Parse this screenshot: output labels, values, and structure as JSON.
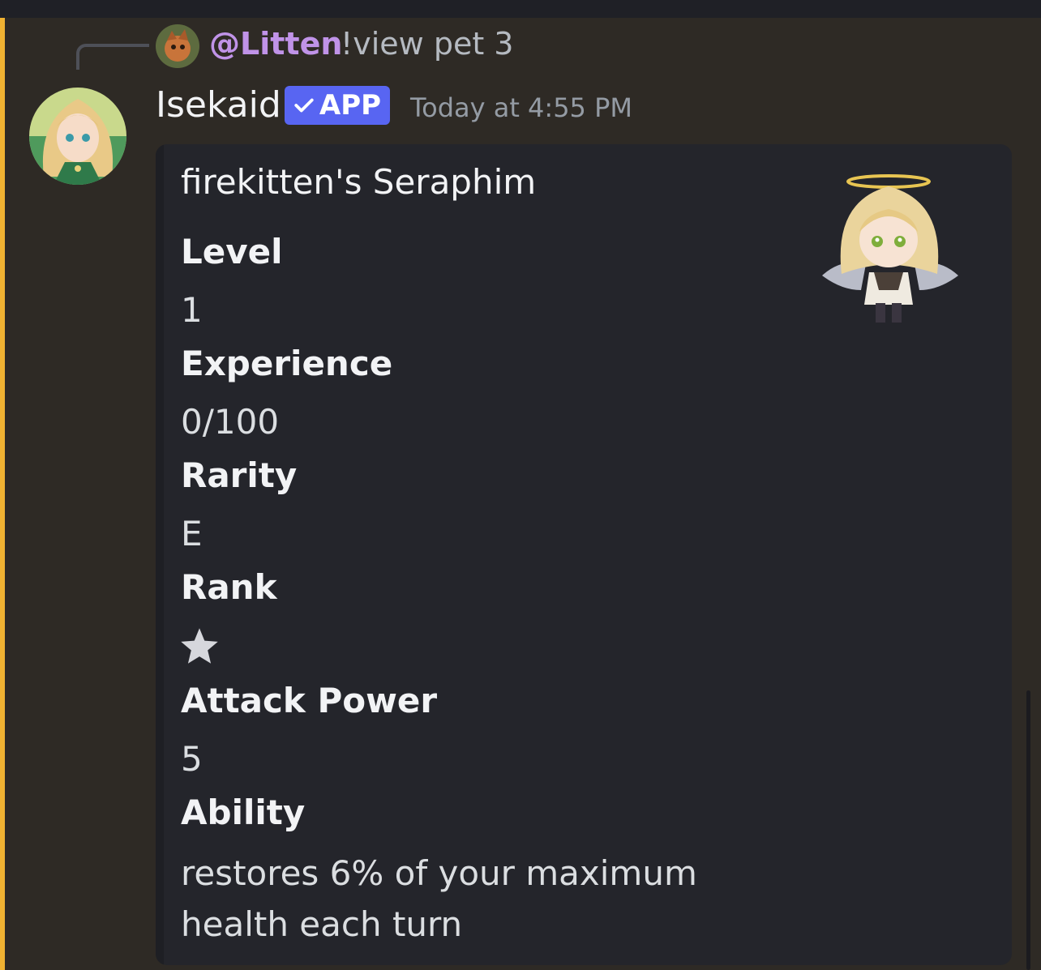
{
  "reply": {
    "username": "@Litten",
    "content": "!view pet 3"
  },
  "message": {
    "author": "Isekaid",
    "badge": "APP",
    "timestamp": "Today at 4:55 PM"
  },
  "embed": {
    "title": "firekitten's Seraphim",
    "fields": [
      {
        "name": "Level",
        "value": "1"
      },
      {
        "name": "Experience",
        "value": "0/100"
      },
      {
        "name": "Rarity",
        "value": "E"
      },
      {
        "name": "Rank",
        "value": "★",
        "icon": "star-icon"
      },
      {
        "name": "Attack Power",
        "value": "5"
      },
      {
        "name": "Ability",
        "value": "restores 6% of your maximum health each turn"
      }
    ]
  },
  "colors": {
    "mention": "#c093e8",
    "app_badge": "#5865f2",
    "highlight_bar": "#f0b232"
  }
}
